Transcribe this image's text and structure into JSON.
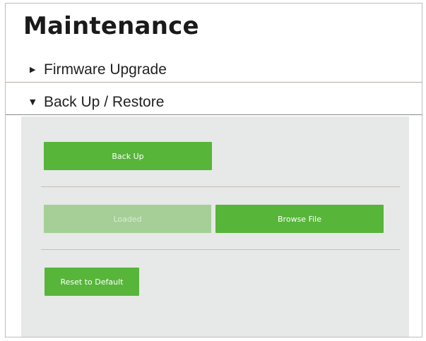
{
  "page": {
    "title": "Maintenance"
  },
  "sections": [
    {
      "label": "Firmware Upgrade",
      "expanded": false,
      "arrow": "▶"
    },
    {
      "label": "Back Up / Restore",
      "expanded": true,
      "arrow": "▼"
    }
  ],
  "backup_restore": {
    "backup_label": "Back Up",
    "file_placeholder": "Loaded",
    "browse_label": "Browse File",
    "reset_label": "Reset to Default"
  },
  "colors": {
    "accent_green": "#57b53a",
    "disabled_green": "#a5cf97",
    "panel_bg": "#e7e8e8"
  }
}
